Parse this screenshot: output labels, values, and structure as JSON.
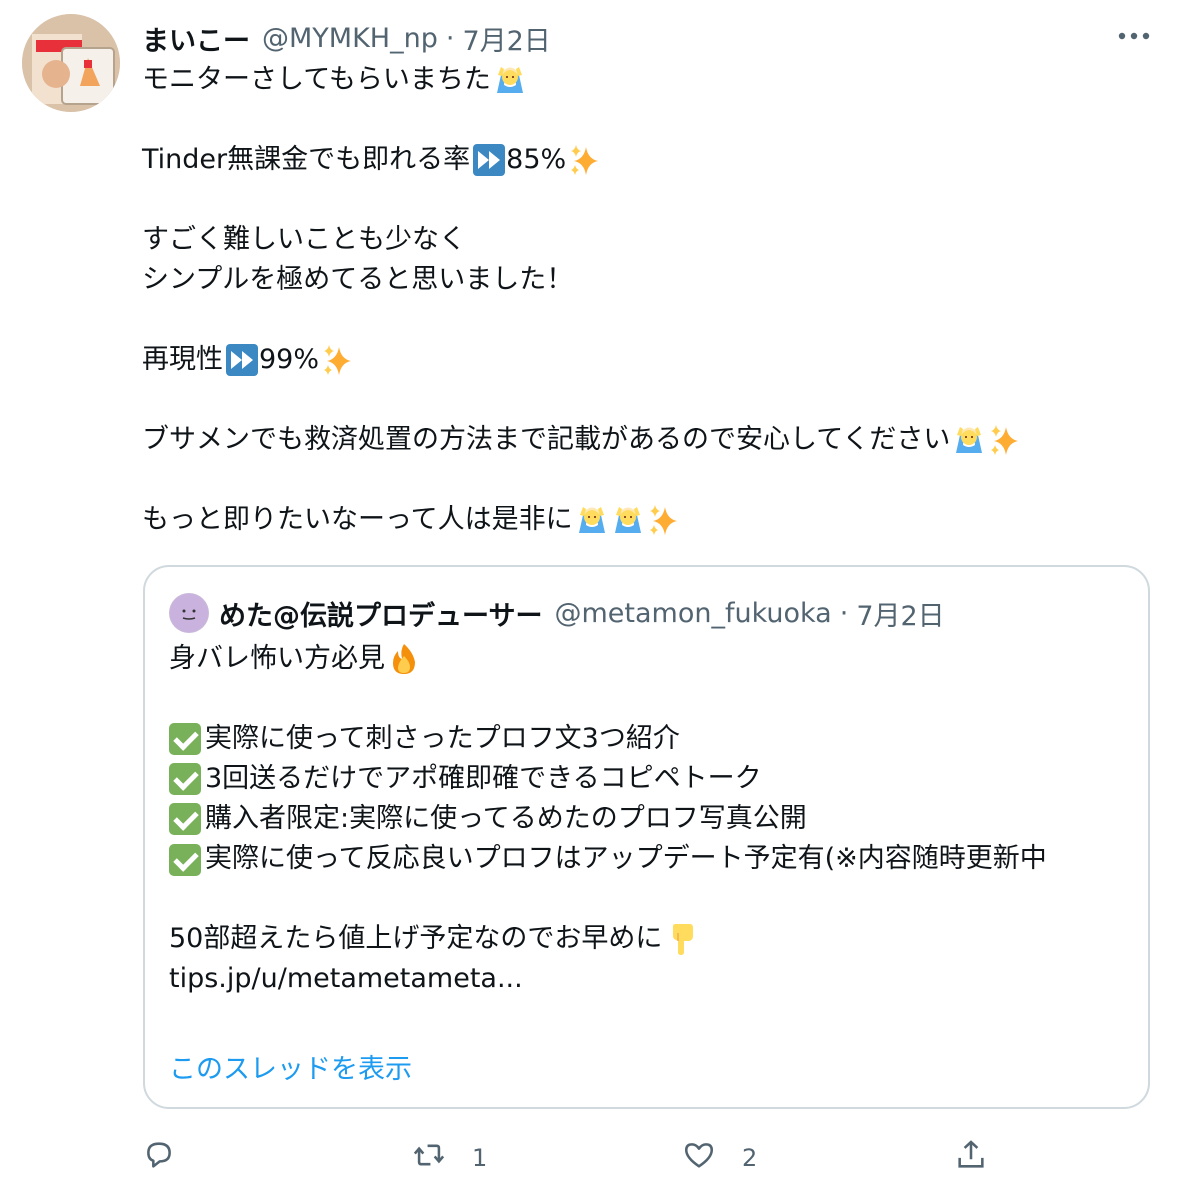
{
  "tweet": {
    "display_name": "まいこー",
    "handle": "@MYMKH_np",
    "separator": "·",
    "date": "7月2日",
    "lines": {
      "l1": "モニターさしてもらいまちた",
      "l2": "Tinder無課金でも即れる率",
      "l2b": "85%",
      "l3": "すごく難しいことも少なく",
      "l4": "シンプルを極めてると思いました！",
      "l5": "再現性",
      "l5b": "99%",
      "l6": "ブサメンでも救済処置の方法まで記載があるので安心してください",
      "l7": "もっと即りたいなーって人は是非に"
    }
  },
  "quote": {
    "display_name": "めた@伝説プロデューサー",
    "handle": "@metamon_fukuoka",
    "separator": "·",
    "date": "7月2日",
    "lines": {
      "q1": "身バレ怖い方必見",
      "q2": " 実際に使って刺さったプロフ文3つ紹介",
      "q3": "3回送るだけでアポ確即確できるコピペトーク",
      "q4": "購入者限定:実際に使ってるめたのプロフ写真公開",
      "q5": "実際に使って反応良いプロフはアップデート予定有(※内容随時更新中",
      "q6": "50部超えたら値上げ予定なのでお早めに",
      "q7": "tips.jp/u/metametameta..."
    },
    "show_thread": "このスレッドを表示"
  },
  "actions": {
    "reply_count": "",
    "retweet_count": "1",
    "like_count": "2"
  },
  "icons": [
    "more-icon",
    "reply-icon",
    "retweet-icon",
    "like-icon",
    "share-icon"
  ],
  "colors": {
    "accent": "#1d9bf0",
    "secondary_text": "#536471",
    "border": "#cfd9de"
  }
}
